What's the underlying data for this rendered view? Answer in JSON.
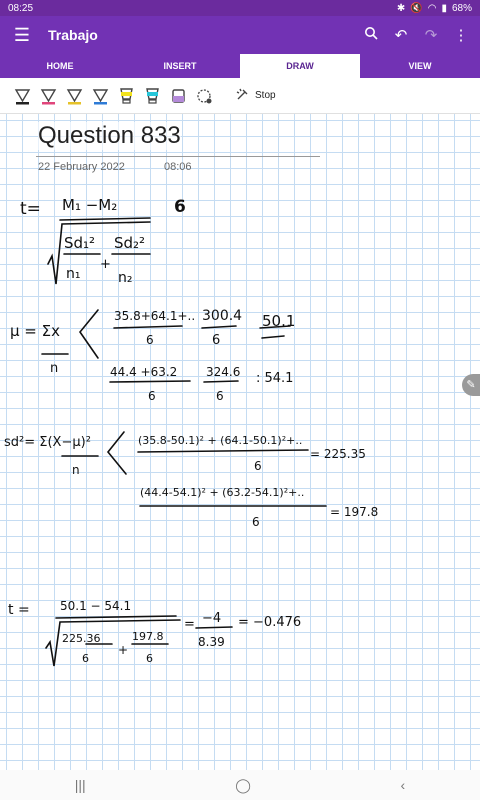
{
  "status": {
    "time": "08:25",
    "battery": "68%"
  },
  "app": {
    "title": "Trabajo"
  },
  "tabs": [
    {
      "label": "HOME"
    },
    {
      "label": "INSERT"
    },
    {
      "label": "DRAW"
    },
    {
      "label": "VIEW"
    }
  ],
  "toolbar": {
    "stop_label": "Stop",
    "pens": [
      "#222222",
      "#e0457b",
      "#e6c229",
      "#2e7bd6",
      "#f2e21c",
      "#26c6d9",
      "#b48ad9"
    ]
  },
  "page": {
    "title": "Question 833",
    "date": "22 February 2022",
    "time": "08:06"
  },
  "ink": {
    "t_label": "t=",
    "mu1_mu2": "M₁ −M₂",
    "six": "6",
    "sd1": "Sd₁²",
    "n1": "n₁",
    "plus": "+",
    "sd2": "Sd₂²",
    "n2": "n₂",
    "mu_formula": "μ = Σx",
    "n": "n",
    "row1_num": "35.8+64.1+..",
    "row1_den": "6",
    "row1_mid": "300.4",
    "row1_mid_den": "6",
    "row1_res": "50.1",
    "row2_num": "44.4 +63.2",
    "row2_den": "6",
    "row2_mid": "324.6",
    "row2_mid_den": "6",
    "row2_res": ": 54.1",
    "sd_formula": "sd²= Σ(X−μ)²",
    "sd_n": "n",
    "sd_row1_num": "(35.8-50.1)² + (64.1-50.1)²+..",
    "sd_row1_den": "6",
    "sd_row1_res": "= 225.35",
    "sd_row2_num": "(44.4-54.1)² + (63.2-54.1)²+..",
    "sd_row2_den": "6",
    "sd_row2_res": "= 197.8",
    "t2_label": "t =",
    "t2_num": "50.1 − 54.1",
    "t2_a_num": "225.36",
    "t2_a_den": "6",
    "t2_plus": "+",
    "t2_b_num": "197.8",
    "t2_b_den": "6",
    "t2_eq": "=",
    "t2_mid_num": "−4",
    "t2_mid_den": "8.39",
    "t2_res": "= −0.476"
  }
}
